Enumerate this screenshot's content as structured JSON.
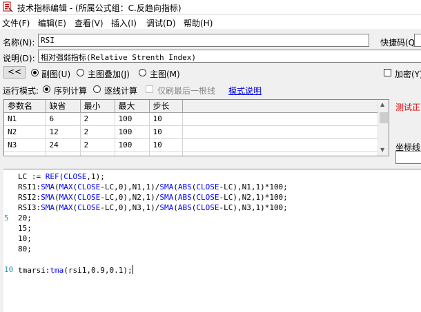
{
  "window": {
    "title": "技术指标编辑 - (所属公式组：C.反趋向指标)"
  },
  "menu": [
    "文件(F)",
    "编辑(E)",
    "查看(V)",
    "插入(I)",
    "调试(D)",
    "帮助(H)"
  ],
  "form": {
    "name_label": "名称(N):",
    "name_value": "RSI",
    "hotkey_label": "快捷码(Q):",
    "desc_label": "说明(D):",
    "desc_value": "相对强弱指标(Relative Strenth Index)",
    "back_button": "<<",
    "chart_modes": [
      "副图(U)",
      "主图叠加(J)",
      "主图(M)"
    ],
    "chart_mode_selected": 0,
    "encrypt_label": "加密(Y)",
    "run_mode_label": "运行模式:",
    "run_modes": [
      "序列计算",
      "逐线计算"
    ],
    "run_mode_selected": 0,
    "refresh_last_label": "仅刷最后一根线",
    "mode_help_link": "模式说明",
    "test_label": "测试正",
    "coord_label": "坐标线"
  },
  "params": {
    "headers": [
      "参数名",
      "缺省",
      "最小",
      "最大",
      "步长"
    ],
    "rows": [
      [
        "N1",
        "6",
        "2",
        "100",
        "10"
      ],
      [
        "N2",
        "12",
        "2",
        "100",
        "10"
      ],
      [
        "N3",
        "24",
        "2",
        "100",
        "10"
      ]
    ]
  },
  "editor": {
    "gutter_numbers": [
      {
        "line": 5,
        "text": "5"
      },
      {
        "line": 10,
        "text": "10"
      }
    ],
    "lines": [
      "LC := REF(CLOSE,1);",
      "RSI1:SMA(MAX(CLOSE-LC,0),N1,1)/SMA(ABS(CLOSE-LC),N1,1)*100;",
      "RSI2:SMA(MAX(CLOSE-LC,0),N2,1)/SMA(ABS(CLOSE-LC),N2,1)*100;",
      "RSI3:SMA(MAX(CLOSE-LC,0),N3,1)/SMA(ABS(CLOSE-LC),N3,1)*100;",
      "20;",
      "15;",
      "10;",
      "80;",
      "",
      "tmarsi:tma(rsi1,0.9,0.1);"
    ]
  }
}
